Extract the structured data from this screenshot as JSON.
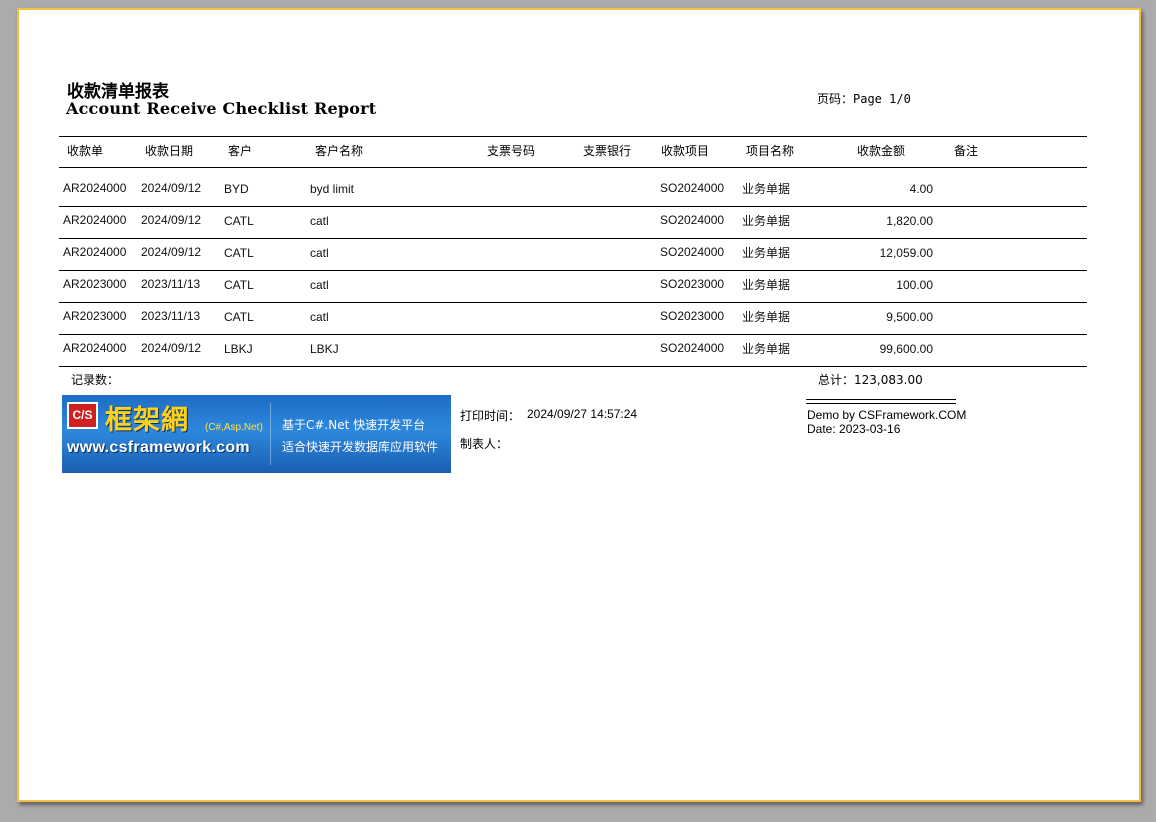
{
  "report": {
    "title_cn": "收款清单报表",
    "title_en": "Account Receive Checklist Report",
    "page_label": "页码：Page 1/0"
  },
  "columns": {
    "receipt_no": "收款单",
    "receipt_date": "收款日期",
    "customer": "客户",
    "customer_name": "客户名称",
    "check_no": "支票号码",
    "check_bank": "支票银行",
    "item": "收款项目",
    "item_name": "项目名称",
    "amount": "收款金额",
    "remark": "备注"
  },
  "rows": [
    {
      "receipt_no": "AR2024000",
      "date": "2024/09/12",
      "customer": "BYD",
      "customer_name": "byd limit",
      "item": "SO2024000",
      "item_name": "业务单据",
      "amount": "4.00"
    },
    {
      "receipt_no": "AR2024000",
      "date": "2024/09/12",
      "customer": "CATL",
      "customer_name": "catl",
      "item": "SO2024000",
      "item_name": "业务单据",
      "amount": "1,820.00"
    },
    {
      "receipt_no": "AR2024000",
      "date": "2024/09/12",
      "customer": "CATL",
      "customer_name": "catl",
      "item": "SO2024000",
      "item_name": "业务单据",
      "amount": "12,059.00"
    },
    {
      "receipt_no": "AR2023000",
      "date": "2023/11/13",
      "customer": "CATL",
      "customer_name": "catl",
      "item": "SO2023000",
      "item_name": "业务单据",
      "amount": "100.00"
    },
    {
      "receipt_no": "AR2023000",
      "date": "2023/11/13",
      "customer": "CATL",
      "customer_name": "catl",
      "item": "SO2023000",
      "item_name": "业务单据",
      "amount": "9,500.00"
    },
    {
      "receipt_no": "AR2024000",
      "date": "2024/09/12",
      "customer": "LBKJ",
      "customer_name": "LBKJ",
      "item": "SO2024000",
      "item_name": "业务单据",
      "amount": "99,600.00"
    }
  ],
  "summary": {
    "record_count_label": "记录数：",
    "total_label": "总计：123,083.00"
  },
  "banner": {
    "cs_badge": "C/S",
    "logo_text": "框架網",
    "logo_tag": "(C#,Asp.Net)",
    "url": "www.csframework.com",
    "line1": "基于C#.Net 快速开发平台",
    "line2": "适合快速开发数据库应用软件"
  },
  "footer": {
    "print_time_label": "打印时间：",
    "print_time_value": "2024/09/27 14:57:24",
    "maker_label": "制表人：",
    "demo_by": "Demo by CSFramework.COM",
    "demo_date": "Date: 2023-03-16"
  },
  "colors": {
    "paper_border": "#f0c040",
    "background": "#ababab",
    "banner_blue": "#2d88dc",
    "logo_yellow": "#ffd21a",
    "badge_red": "#d12020"
  }
}
